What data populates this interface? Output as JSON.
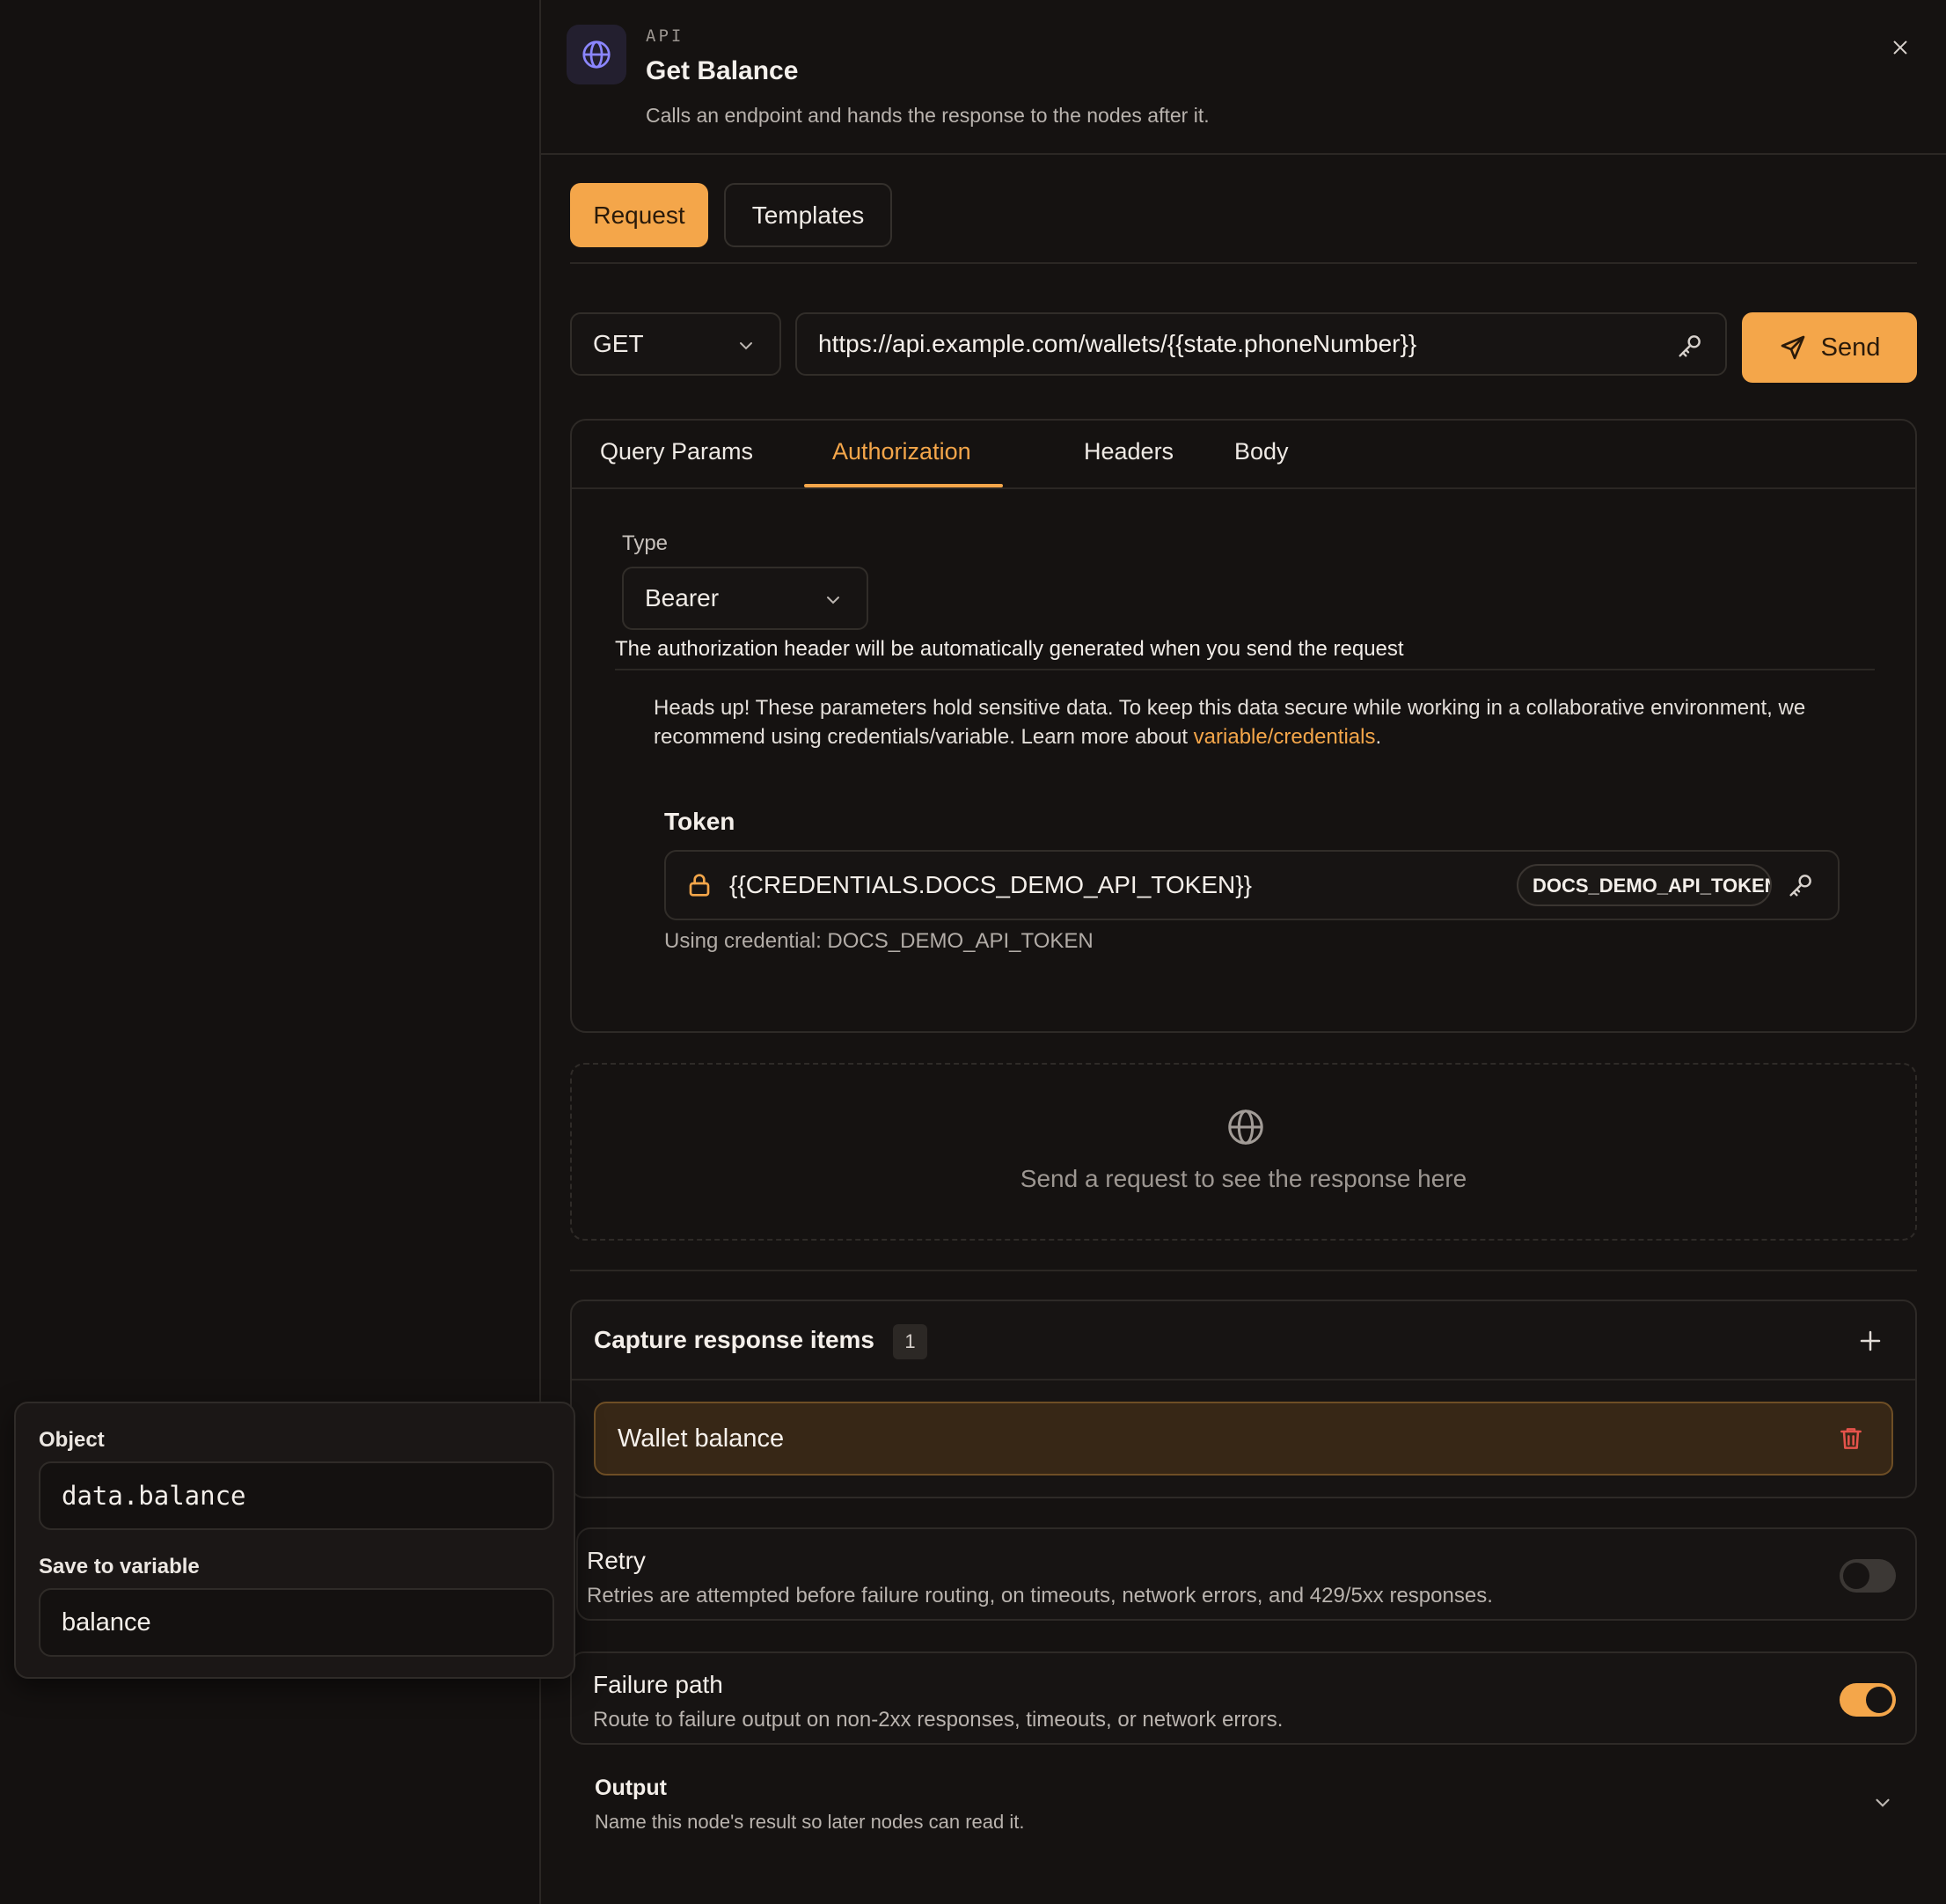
{
  "header": {
    "eyebrow": "API",
    "title": "Get Balance",
    "description": "Calls an endpoint and hands the response to the nodes after it."
  },
  "tabs": [
    {
      "label": "Request",
      "active": true
    },
    {
      "label": "Templates",
      "active": false
    }
  ],
  "request": {
    "method": "GET",
    "url": "https://api.example.com/wallets/{{state.phoneNumber}}",
    "send_label": "Send"
  },
  "subtabs": [
    {
      "label": "Query Params",
      "active": false
    },
    {
      "label": "Authorization",
      "active": true
    },
    {
      "label": "Headers",
      "active": false
    },
    {
      "label": "Body",
      "active": false
    }
  ],
  "auth": {
    "type_label": "Type",
    "type_value": "Bearer",
    "note": "The authorization header will be automatically generated when you send the request",
    "heads_up": "Heads up! These parameters hold sensitive data. To keep this data secure while working in a collaborative environment, we recommend using credentials/variable. Learn more about ",
    "heads_up_link": "variable/credentials",
    "heads_up_end": ".",
    "token_label": "Token",
    "token_value": "{{CREDENTIALS.DOCS_DEMO_API_TOKEN}}",
    "credential_chip": "DOCS_DEMO_API_TOKEN",
    "using_credential": "Using credential: DOCS_DEMO_API_TOKEN"
  },
  "response": {
    "placeholder": "Send a request to see the response here"
  },
  "capture": {
    "title": "Capture response items",
    "count": "1",
    "items": [
      {
        "label": "Wallet balance"
      }
    ]
  },
  "retry": {
    "title": "Retry",
    "description": "Retries are attempted before failure routing, on timeouts, network errors, and 429/5xx responses.",
    "enabled": false
  },
  "failure": {
    "title": "Failure path",
    "description": "Route to failure output on non-2xx responses, timeouts, or network errors.",
    "enabled": true
  },
  "output": {
    "title": "Output",
    "description": "Name this node's result so later nodes can read it."
  },
  "popover": {
    "object_label": "Object",
    "object_value": "data.balance",
    "variable_label": "Save to variable",
    "variable_value": "balance"
  },
  "colors": {
    "accent": "#f4a64a",
    "background": "#141110",
    "card_border": "#2e2a27"
  },
  "icons": {
    "header": "globe-icon",
    "close": "close-icon",
    "method": "chevron-down-icon",
    "url": "key-icon",
    "send": "send-icon",
    "token_lock": "lock-icon",
    "token_key": "key-icon",
    "response": "globe-icon",
    "capture_add": "plus-icon",
    "capture_delete": "trash-icon",
    "output": "chevron-down-icon"
  }
}
